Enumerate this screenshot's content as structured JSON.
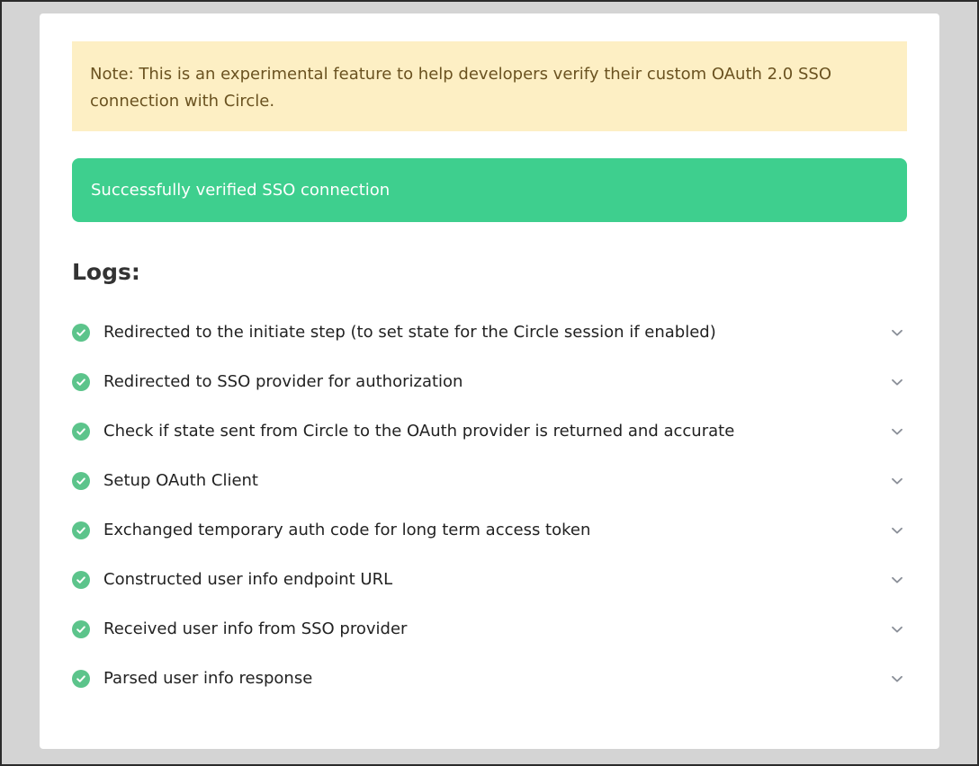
{
  "note": {
    "text": "Note: This is an experimental feature to help developers verify their custom OAuth 2.0 SSO connection with Circle."
  },
  "success": {
    "text": "Successfully verified SSO connection"
  },
  "logs": {
    "title": "Logs:",
    "items": [
      {
        "label": "Redirected to the initiate step (to set state for the Circle session if enabled)",
        "status_icon": "check-circle-icon",
        "expand_icon": "chevron-down-icon"
      },
      {
        "label": "Redirected to SSO provider for authorization",
        "status_icon": "check-circle-icon",
        "expand_icon": "chevron-down-icon"
      },
      {
        "label": "Check if state sent from Circle to the OAuth provider is returned and accurate",
        "status_icon": "check-circle-icon",
        "expand_icon": "chevron-down-icon"
      },
      {
        "label": "Setup OAuth Client",
        "status_icon": "check-circle-icon",
        "expand_icon": "chevron-down-icon"
      },
      {
        "label": "Exchanged temporary auth code for long term access token",
        "status_icon": "check-circle-icon",
        "expand_icon": "chevron-down-icon"
      },
      {
        "label": "Constructed user info endpoint URL",
        "status_icon": "check-circle-icon",
        "expand_icon": "chevron-down-icon"
      },
      {
        "label": "Received user info from SSO provider",
        "status_icon": "check-circle-icon",
        "expand_icon": "chevron-down-icon"
      },
      {
        "label": "Parsed user info response",
        "status_icon": "check-circle-icon",
        "expand_icon": "chevron-down-icon"
      }
    ]
  },
  "colors": {
    "page_background": "#d4d4d4",
    "note_background": "#fdefc4",
    "note_text": "#6a5220",
    "success_background": "#3ecf8e",
    "check_green": "#5cc48b",
    "chevron_gray": "#8a8f98"
  }
}
